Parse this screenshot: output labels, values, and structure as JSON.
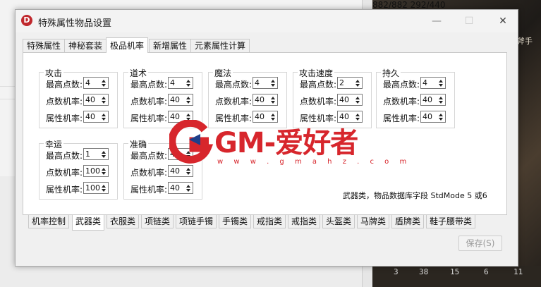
{
  "window": {
    "title": "特殊属性物品设置",
    "icon_letter": "D",
    "minimize": "—",
    "maximize": "☐",
    "close": "✕"
  },
  "background": {
    "hud_top": "882/882 292/440",
    "side_label": "斧手",
    "bottom_numbers": [
      "3",
      "38",
      "15",
      "6",
      "11"
    ]
  },
  "top_tabs": [
    "特殊属性",
    "神秘套装",
    "极品机率",
    "新增属性",
    "元素属性计算"
  ],
  "active_top_tab": "极品机率",
  "labels": {
    "max_points": "最高点数:",
    "point_rate": "点数机率:",
    "attr_rate": "属性机率:"
  },
  "groups": [
    {
      "title": "攻击",
      "max_points": "4",
      "point_rate": "40",
      "attr_rate": "40"
    },
    {
      "title": "道术",
      "max_points": "4",
      "point_rate": "40",
      "attr_rate": "40"
    },
    {
      "title": "魔法",
      "max_points": "4",
      "point_rate": "40",
      "attr_rate": "40"
    },
    {
      "title": "攻击速度",
      "max_points": "2",
      "point_rate": "40",
      "attr_rate": "40"
    },
    {
      "title": "持久",
      "max_points": "4",
      "point_rate": "40",
      "attr_rate": "40"
    },
    {
      "title": "幸运",
      "max_points": "1",
      "point_rate": "100",
      "attr_rate": "100"
    },
    {
      "title": "准确",
      "max_points": "4",
      "point_rate": "40",
      "attr_rate": "40"
    }
  ],
  "note": "武器类，物品数据库字段 StdMode 5 或6",
  "bottom_tabs": [
    "机率控制",
    "武器类",
    "衣服类",
    "项链类",
    "项链手镯",
    "手镯类",
    "戒指类",
    "戒指类",
    "头盔类",
    "马牌类",
    "盾牌类",
    "鞋子腰带类"
  ],
  "active_bottom_tab": "武器类",
  "save_button": "保存(S)",
  "watermark": {
    "text": "GM-爱好者",
    "url": "w w w . g m a h z . c o m"
  },
  "colors": {
    "watermark_red": "#d7262c",
    "window_bg": "#f0f0f0"
  }
}
